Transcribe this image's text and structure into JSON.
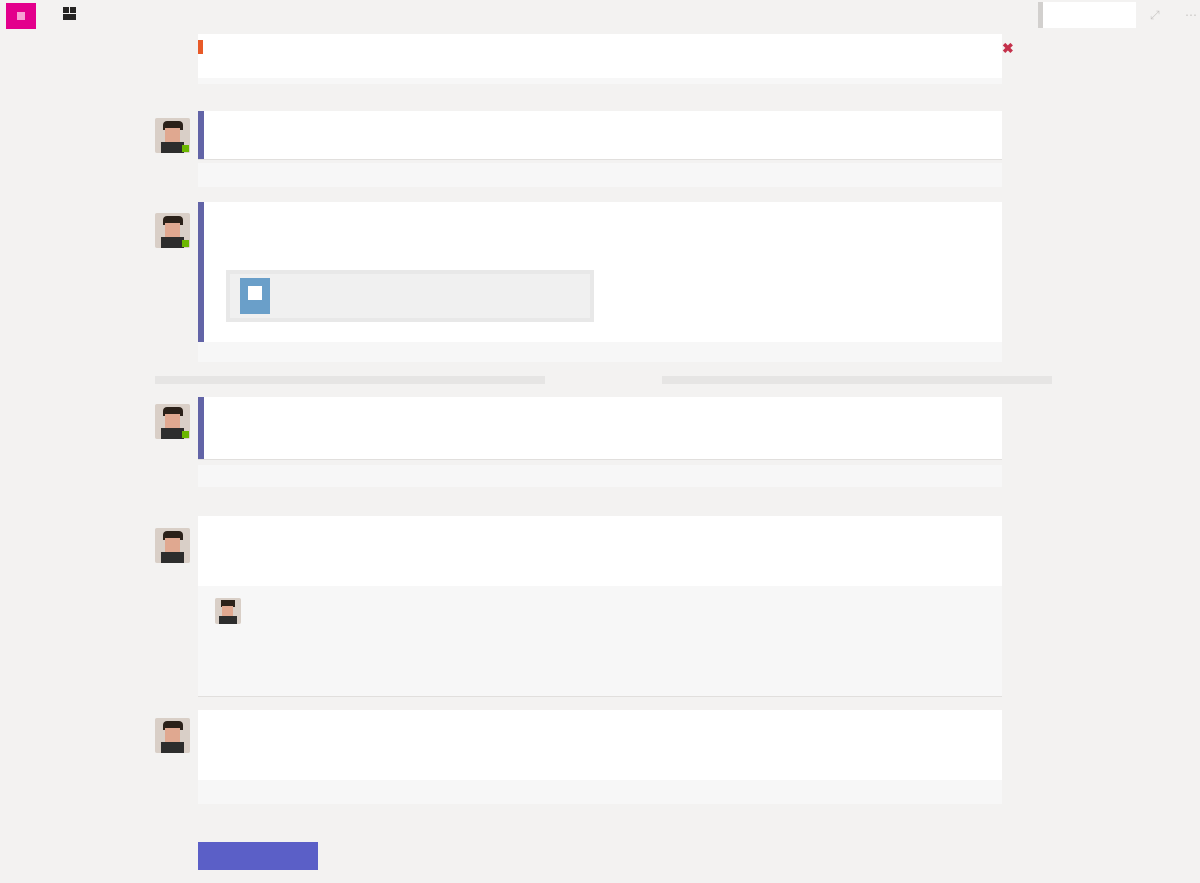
{
  "app": {
    "accent_color": "#e3008c",
    "icon": "app-tile-icon"
  },
  "header": {
    "team": "",
    "breadcrumb": "",
    "search_value": ""
  },
  "feed": {
    "top_card": {
      "link_text": "",
      "footer": ""
    },
    "divider_top": "",
    "messages": [
      {
        "header": "",
        "body": "",
        "footer": ""
      },
      {
        "header": "",
        "body": "",
        "attachment": "",
        "footer": ""
      },
      {
        "header": "",
        "line1": "",
        "line2": "",
        "footer": ""
      },
      {
        "header": "",
        "line1": "",
        "line2": "",
        "reply": {
          "header": "",
          "line1": "",
          "line2": "",
          "line3": "",
          "footer": ""
        }
      },
      {
        "header": "",
        "line1": "",
        "line2": "",
        "footer": ""
      }
    ],
    "divider_1": "",
    "divider_2": ""
  },
  "compose_button": "",
  "colors": {
    "accent": "#6264a7",
    "button": "#5b5fc7",
    "presence": "#6bb700",
    "alert": "#e85a28"
  }
}
